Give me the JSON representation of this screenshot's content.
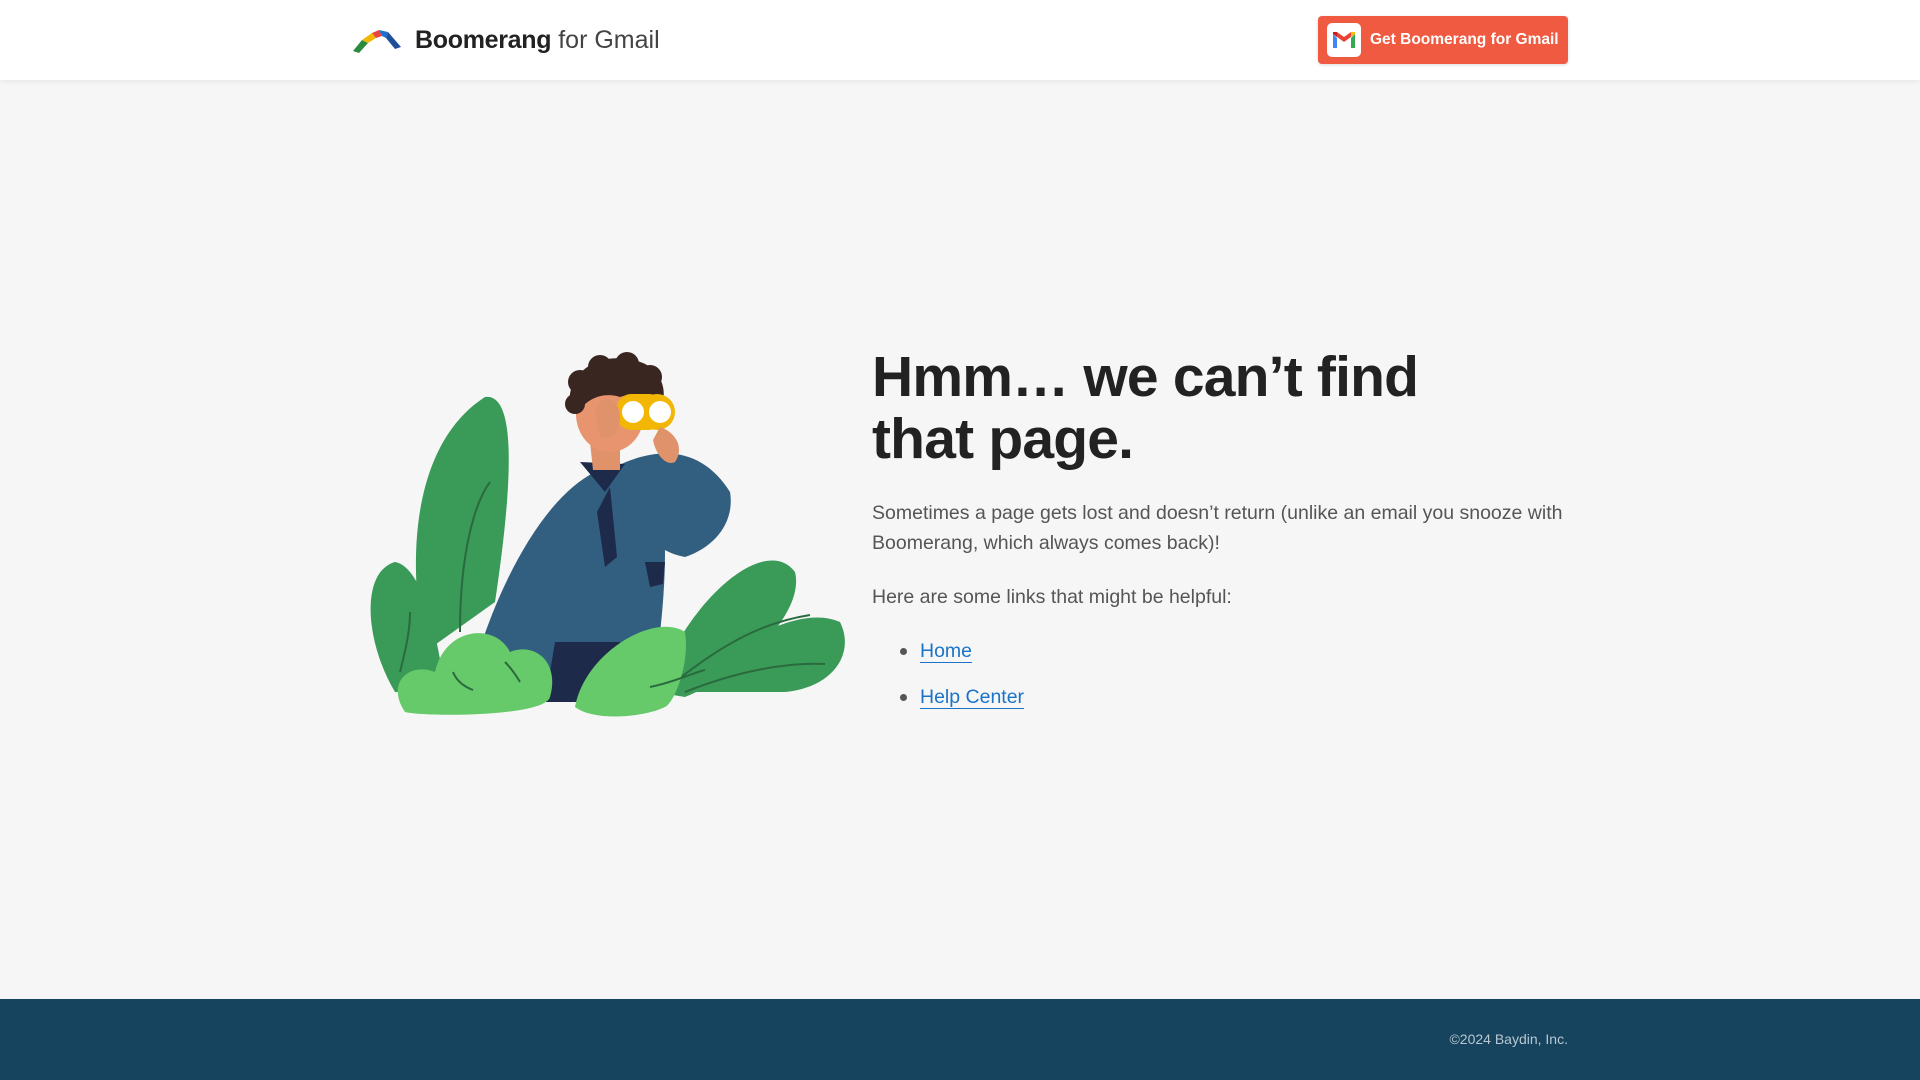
{
  "header": {
    "logo_brand": "Boomerang",
    "logo_suffix": "for Gmail",
    "cta_label": "Get Boomerang for Gmail"
  },
  "main": {
    "title_line1": "Hmm… we can’t find",
    "title_line2": "that page.",
    "description": "Sometimes a page gets lost and doesn’t return (unlike an email you snooze with Boomerang, which always comes back)!",
    "helpful_text": "Here are some links that might be helpful:",
    "links": [
      {
        "label": "Home"
      },
      {
        "label": "Help Center"
      }
    ]
  },
  "footer": {
    "copyright": "©2024 Baydin, Inc."
  },
  "colors": {
    "cta": "#ef5a40",
    "link": "#1a73c9",
    "footer": "#16435e",
    "plant_dark": "#3a9a58",
    "plant_light": "#66c96a",
    "shirt": "#325f80"
  },
  "icons": {
    "logo": "boomerang-logo-icon",
    "cta": "gmail-icon",
    "illustration": "person-with-binoculars-illustration"
  }
}
